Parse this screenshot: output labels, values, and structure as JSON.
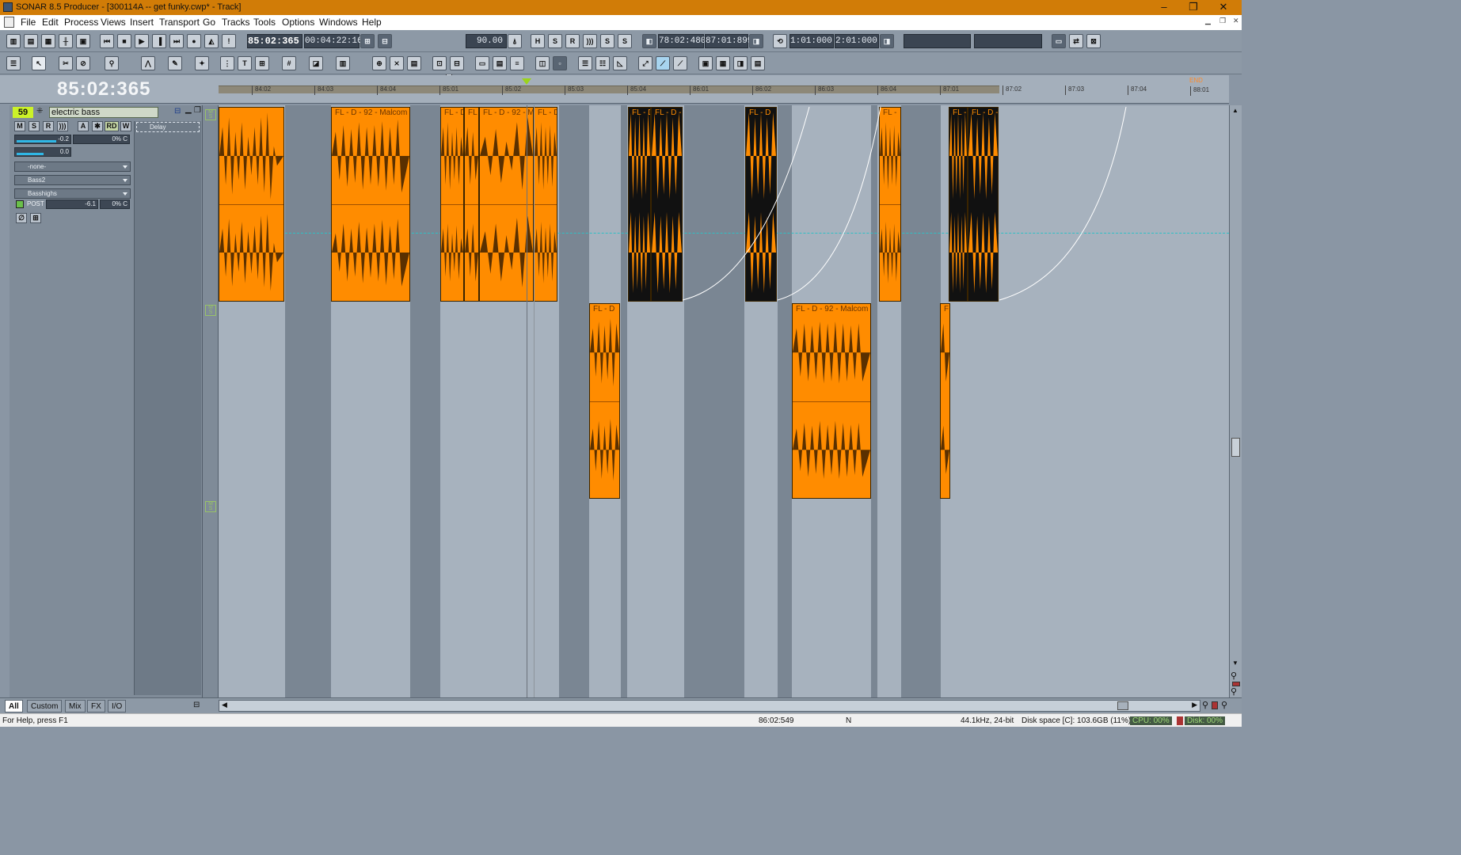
{
  "app": {
    "title": "SONAR 8.5 Producer - [300114A -- get funky.cwp* - Track]",
    "menus": [
      "File",
      "Edit",
      "Process",
      "Views",
      "Insert",
      "Transport",
      "Go",
      "Tracks",
      "Tools",
      "Options",
      "Windows",
      "Help"
    ],
    "window_controls": {
      "minimize": "–",
      "restore": "❐",
      "close": "✕"
    }
  },
  "transport": {
    "now_time": "85:02:365",
    "smpte": "00:04:22:16",
    "tempo": "90.00",
    "loop_start": "78:02:480",
    "loop_end": "87:01:899",
    "punch_start": "1:01:000",
    "punch_end": "2:01:000"
  },
  "big_clock": "85:02:365",
  "ruler": {
    "ticks": [
      "84:02",
      "84:03",
      "84:04",
      "85:01",
      "85:02",
      "85:03",
      "85:04",
      "86:01",
      "86:02",
      "86:03",
      "86:04",
      "87:01",
      "87:02",
      "87:03",
      "87:04",
      "88:01"
    ],
    "end_label": "END"
  },
  "track": {
    "number": "59",
    "name": "electric bass",
    "buttons": [
      "M",
      "S",
      "R",
      "A",
      "RD",
      "W"
    ],
    "volume": "-0.2",
    "pan": "0% C",
    "trim": "0.0",
    "input": "-none-",
    "output": "Bass2",
    "send": "Basshighs",
    "send_mode": "POST",
    "send_level": "-6.1",
    "send_pan": "0% C",
    "fx": "Delay"
  },
  "clips": [
    {
      "label": "FL - D - 92 - Malcom"
    },
    {
      "label": "FL - D"
    },
    {
      "label": "FL"
    },
    {
      "label": "FL - D - 92 - Ma"
    },
    {
      "label": "FL - D"
    },
    {
      "label": "FL - D"
    },
    {
      "label": "FL - D - S"
    },
    {
      "label": "FL - D - S"
    },
    {
      "label": "FL - D"
    },
    {
      "label": "FL -"
    },
    {
      "label": "FL - D - S"
    },
    {
      "label": "FL - D -"
    },
    {
      "label": "FL - D - 92 - Malcom"
    },
    {
      "label": "F"
    }
  ],
  "bottom_tabs": [
    "All",
    "Custom",
    "Mix",
    "FX",
    "I/O"
  ],
  "status": {
    "help": "For Help, press F1",
    "position": "86:02:549",
    "mode": "N",
    "format": "44.1kHz, 24-bit",
    "disk_space": "Disk space [C]: 103.6GB (11%)",
    "cpu": "CPU: 00%",
    "disk": "Disk: 00%"
  },
  "colors": {
    "title_bar": "#d17c07",
    "clip": "#ff8c00",
    "clip_dark": "#111111",
    "track_number": "#ccf228",
    "playhead": "#9bd31b"
  }
}
